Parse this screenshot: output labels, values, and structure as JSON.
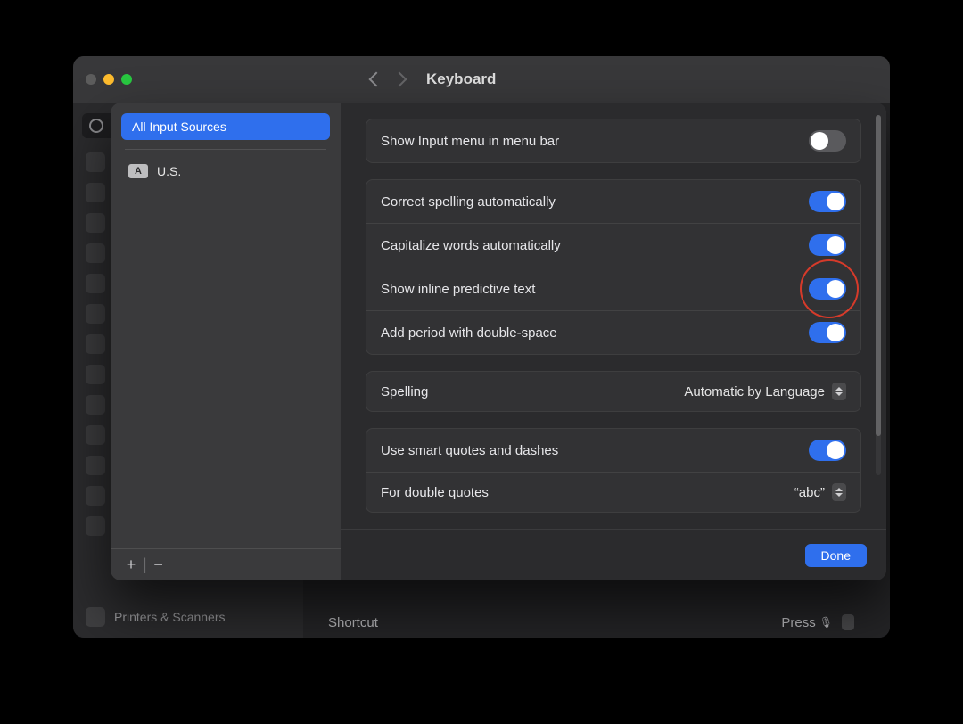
{
  "header": {
    "title": "Keyboard"
  },
  "bg_sidebar": {
    "bottom_label": "Printers & Scanners"
  },
  "bg_content": {
    "shortcut_label": "Shortcut",
    "shortcut_value": "Press"
  },
  "sheet": {
    "sources": {
      "all_label": "All Input Sources",
      "items": [
        {
          "badge": "A",
          "label": "U.S."
        }
      ]
    },
    "footer": {
      "add": "+",
      "remove": "−"
    },
    "settings": {
      "group1": [
        {
          "label": "Show Input menu in menu bar",
          "on": false
        }
      ],
      "group2": [
        {
          "label": "Correct spelling automatically",
          "on": true
        },
        {
          "label": "Capitalize words automatically",
          "on": true
        },
        {
          "label": "Show inline predictive text",
          "on": true,
          "highlight": true
        },
        {
          "label": "Add period with double-space",
          "on": true
        }
      ],
      "group3": [
        {
          "label": "Spelling",
          "value": "Automatic by Language"
        }
      ],
      "group4": [
        {
          "label": "Use smart quotes and dashes",
          "on": true
        },
        {
          "label": "For double quotes",
          "value": "“abc”"
        }
      ]
    },
    "done": "Done"
  }
}
